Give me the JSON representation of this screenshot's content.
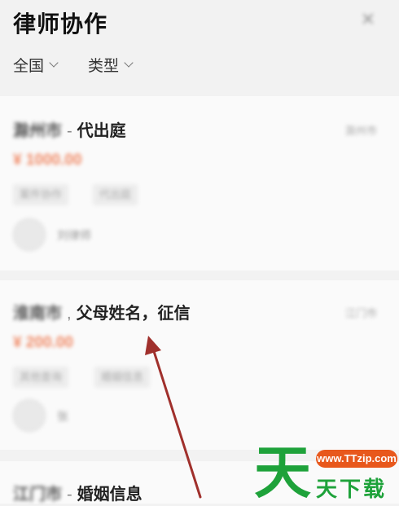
{
  "header": {
    "title": "律师协作",
    "filters": [
      {
        "label": "全国"
      },
      {
        "label": "类型"
      }
    ]
  },
  "cards": [
    {
      "location": "滁州市",
      "subject": "代出庭",
      "right_tag": "滁州市",
      "price": "¥ 1000.00",
      "tags": [
        "案件协作",
        "代出庭"
      ],
      "poster": "刘律师"
    },
    {
      "location": "淮南市",
      "subject": "父母姓名，征信",
      "right_tag": "江门市",
      "price": "¥ 200.00",
      "tags": [
        "其他查询",
        "婚姻信息"
      ],
      "poster": "张"
    },
    {
      "location": "江门市",
      "subject": "婚姻信息"
    }
  ],
  "watermark": {
    "big_char": "天",
    "url": "www.TTzip.com",
    "text": "天下载"
  },
  "colors": {
    "price": "#f08a66",
    "arrow": "#a0302c",
    "watermark_green": "#1ea23a",
    "watermark_orange": "#e8581c"
  }
}
